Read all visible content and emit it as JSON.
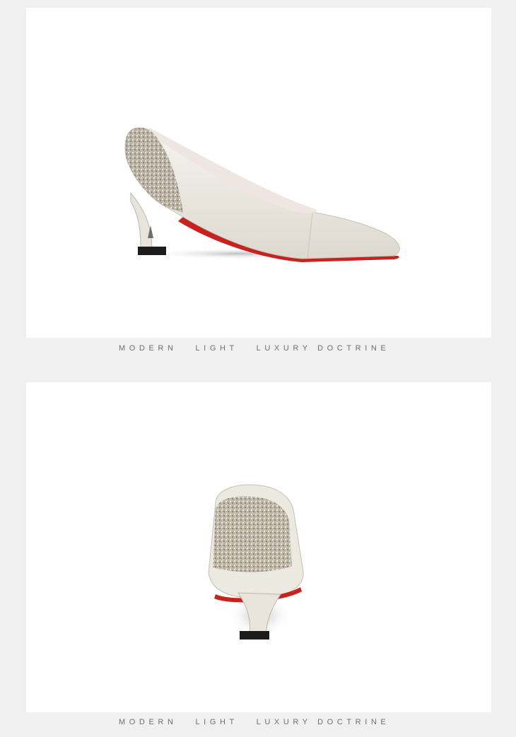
{
  "sections": [
    {
      "image": "shoe-side-view",
      "caption": "MODERN   LIGHT   LUXURY DOCTRINE"
    },
    {
      "image": "shoe-back-view",
      "caption": "MODERN   LIGHT   LUXURY DOCTRINE"
    }
  ],
  "colors": {
    "background": "#f0f0f0",
    "panel": "#ffffff",
    "leather": "#ece9e1",
    "sole_accent": "#c8221e",
    "caption_text": "#6f6f6f"
  }
}
